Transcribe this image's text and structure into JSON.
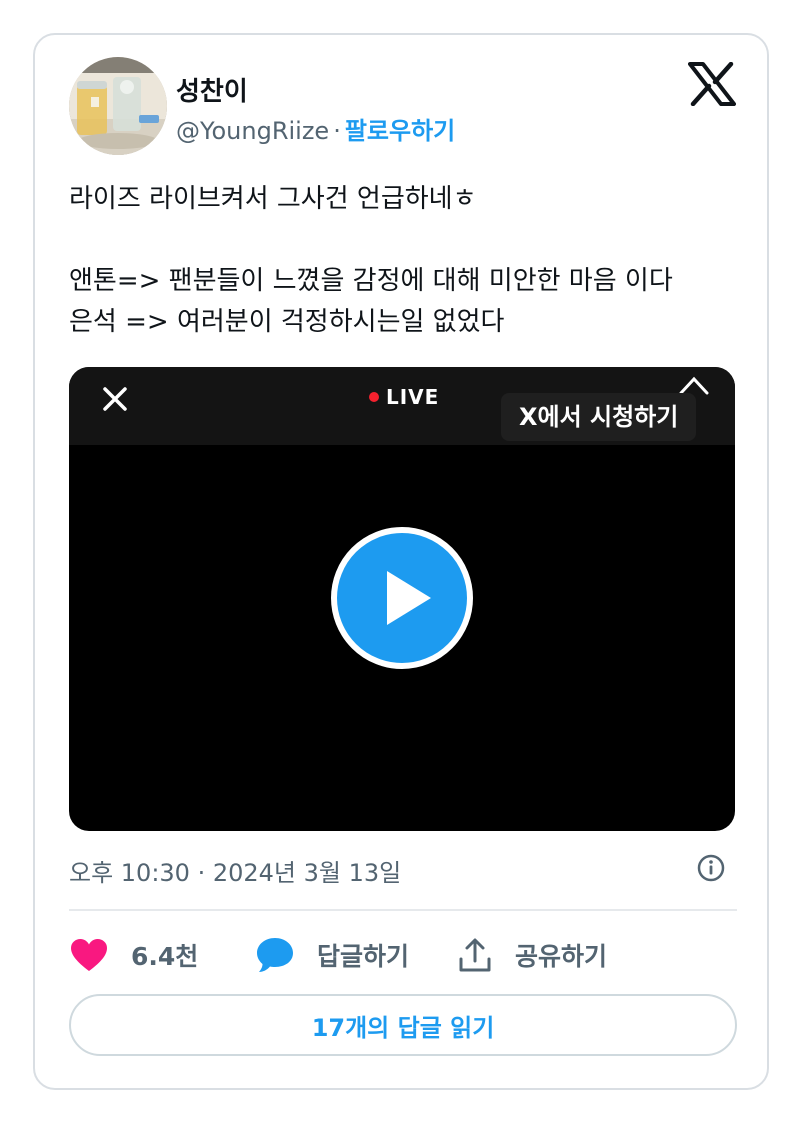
{
  "author": {
    "name": "성찬이",
    "handle": "@YoungRiize",
    "separator": "·",
    "follow_label": "팔로우하기"
  },
  "tweet": {
    "text": "라이즈 라이브켜서 그사건 언급하네ㅎ\n\n앤톤=> 팬분들이 느꼈을 감정에 대해 미안한 마음 이다\n은석 => 여러분이 걱정하시는일 없었다"
  },
  "video": {
    "live_label": "LIVE",
    "watch_on_x_label": "X에서 시청하기",
    "close_icon": "close-icon",
    "play_icon": "play-icon"
  },
  "meta": {
    "timestamp": "오후 10:30 · 2024년 3월 13일"
  },
  "actions": {
    "like_count": "6.4천",
    "reply_label": "답글하기",
    "share_label": "공유하기"
  },
  "replies_button": "17개의 답글 읽기",
  "colors": {
    "accent": "#1d9bf0",
    "like": "#f91880",
    "live": "#f4212e",
    "secondary_text": "#536471"
  }
}
